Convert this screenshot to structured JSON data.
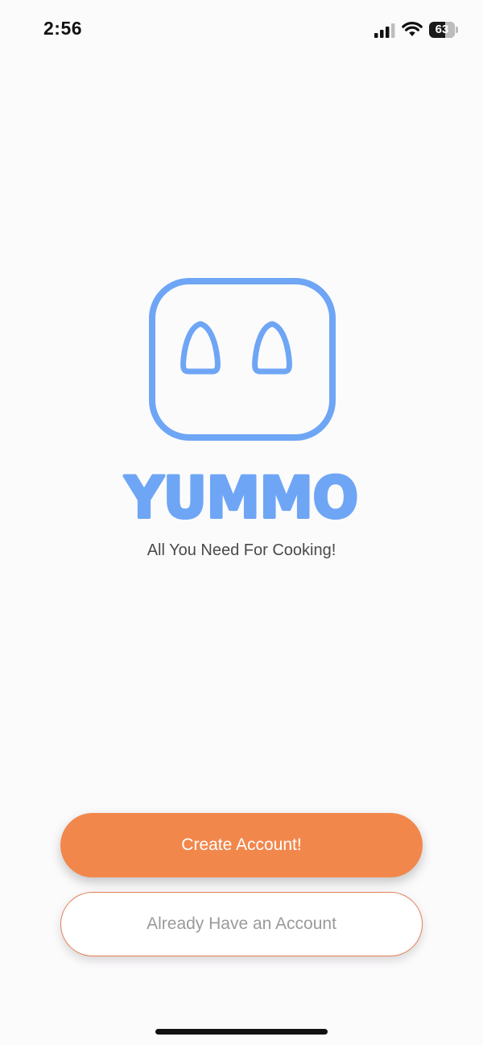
{
  "status_bar": {
    "time": "2:56",
    "battery_level": "63",
    "icons": [
      "signal-icon",
      "wifi-icon",
      "battery-icon"
    ]
  },
  "brand": {
    "name": "YUMMO",
    "tagline": "All You Need For Cooking!",
    "color": "#6ea6f5"
  },
  "actions": {
    "create_account_label": "Create Account!",
    "login_label": "Already Have an Account",
    "primary_color": "#f2874c"
  }
}
